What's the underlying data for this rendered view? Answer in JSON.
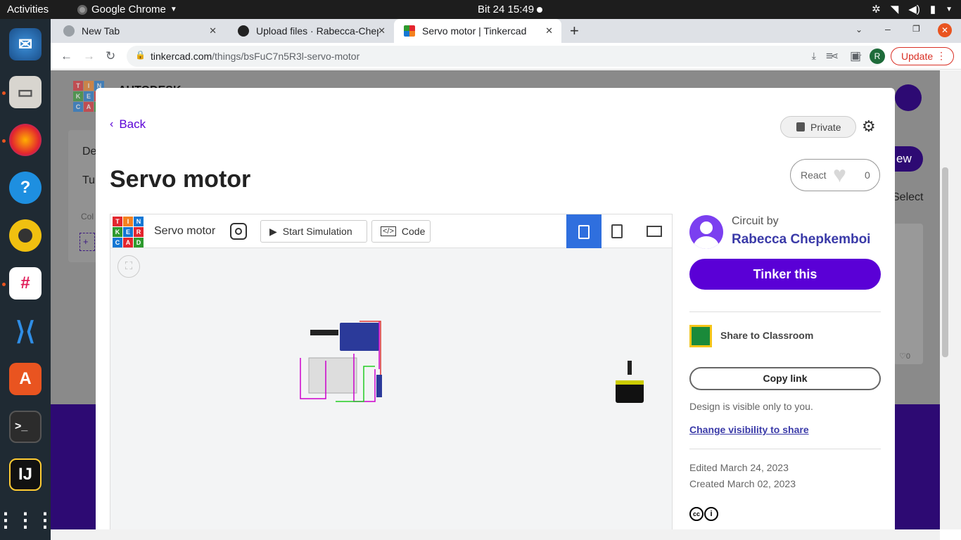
{
  "system": {
    "activities": "Activities",
    "app_name": "Google Chrome",
    "clock": "Bit 24  15:49"
  },
  "dock": {
    "items": [
      "thunderbird-icon",
      "files-icon",
      "firefox-icon",
      "help-icon",
      "rhythmbox-icon",
      "slack-icon",
      "vscode-icon",
      "app-store-icon",
      "terminal-icon",
      "intellij-icon",
      "show-apps-icon"
    ]
  },
  "tabs": [
    {
      "title": "New Tab",
      "close": "✕"
    },
    {
      "title": "Upload files · Rabecca-Chepkemboi",
      "close": "✕"
    },
    {
      "title": "Servo motor | Tinkercad",
      "close": "✕"
    }
  ],
  "browser": {
    "url_host": "tinkercad.com",
    "url_path": "/things/bsFuC7n5R3l-servo-motor",
    "update_label": "Update",
    "profile_initial": "R"
  },
  "background": {
    "logo_letters": [
      "T",
      "I",
      "N",
      "K",
      "E",
      "R",
      "C",
      "A",
      "D"
    ],
    "brand": "AUTODESK",
    "menu": [
      "De",
      "Tu"
    ],
    "collection": "Col",
    "new_btn": "ew",
    "select": "Select",
    "like_count": "♡0"
  },
  "modal": {
    "back_label": "Back",
    "private_label": "Private",
    "title": "Servo motor",
    "react_label": "React",
    "react_count": "0",
    "viewer": {
      "title": "Servo motor",
      "start_simulation": "Start Simulation",
      "code": "Code"
    },
    "circuit_by": "Circuit by",
    "author": "Rabecca Chepkemboi",
    "tinker_label": "Tinker this",
    "share_classroom": "Share to Classroom",
    "copy_link": "Copy link",
    "visibility_note": "Design is visible only to you.",
    "change_visibility": "Change visibility to share",
    "edited": "Edited March 24, 2023",
    "created": "Created March 02, 2023"
  },
  "colors": {
    "accent": "#5a00d6",
    "tk_red": "#e3262e",
    "tk_orange": "#f4811f",
    "tk_blue": "#1477d4",
    "tk_green": "#2e9a2e"
  }
}
